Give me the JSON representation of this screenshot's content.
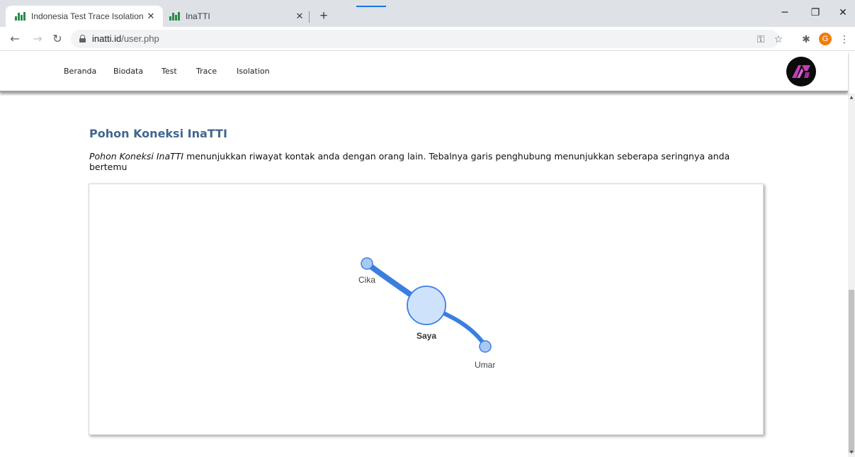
{
  "browser": {
    "tabs": [
      {
        "title": "Indonesia Test Trace Isolation",
        "active": true
      },
      {
        "title": "InaTTI",
        "active": false
      }
    ],
    "close_glyph": "✕",
    "new_tab_glyph": "+",
    "url_host": "inatti.id",
    "url_path": "/user.php",
    "profile_initial": "G",
    "accent": "#1a73e8",
    "profile_color": "#f07d0c"
  },
  "nav": {
    "links": [
      "Beranda",
      "Biodata",
      "Test",
      "Trace",
      "Isolation"
    ]
  },
  "main": {
    "heading": "Pohon Koneksi InaTTI",
    "desc_em": "Pohon Koneksi InaTTI",
    "desc_rest": " menunjukkan riwayat kontak anda dengan orang lain. Tebalnya garis penghubung menunjukkan seberapa seringnya anda bertemu",
    "title_color": "#40668e"
  },
  "graph": {
    "center": "Saya",
    "contacts": [
      {
        "name": "Cika"
      },
      {
        "name": "Umar"
      }
    ],
    "edge_color": "#3a7fe0",
    "node_fill": "#cfe2fb",
    "node_stroke": "#3a7fe0"
  }
}
